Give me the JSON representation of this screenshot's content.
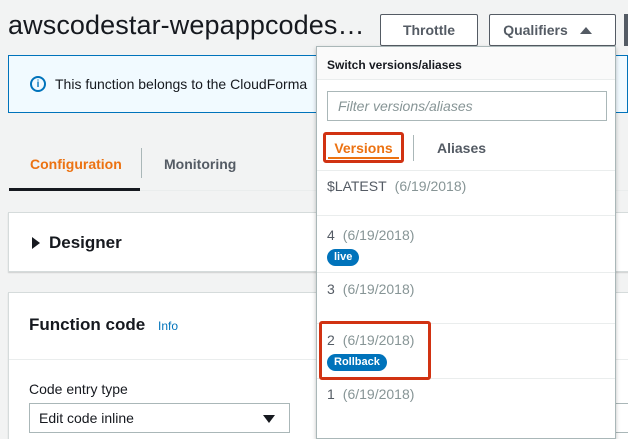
{
  "header": {
    "function_title": "awscodestar-wepappcodes…",
    "throttle_label": "Throttle",
    "qualifiers_label": "Qualifiers"
  },
  "banner": {
    "text": "This function belongs to the CloudForma"
  },
  "tabs": [
    {
      "label": "Configuration",
      "active": true
    },
    {
      "label": "Monitoring",
      "active": false
    }
  ],
  "designer": {
    "title": "Designer"
  },
  "function_code": {
    "title": "Function code",
    "info_link": "Info",
    "entry_type_label": "Code entry type",
    "entry_type_value": "Edit code inline"
  },
  "dropdown": {
    "header": "Switch versions/aliases",
    "filter_placeholder": "Filter versions/aliases",
    "tabs": [
      {
        "label": "Versions",
        "active": true
      },
      {
        "label": "Aliases",
        "active": false
      }
    ],
    "versions": [
      {
        "name": "$LATEST",
        "date": "(6/19/2018)",
        "badge": ""
      },
      {
        "name": "4",
        "date": "(6/19/2018)",
        "badge": "live"
      },
      {
        "name": "3",
        "date": "(6/19/2018)",
        "badge": ""
      },
      {
        "name": "2",
        "date": "(6/19/2018)",
        "badge": "Rollback"
      },
      {
        "name": "1",
        "date": "(6/19/2018)",
        "badge": ""
      }
    ]
  },
  "colors": {
    "accent_orange": "#ec7211",
    "badge_blue": "#0073bb",
    "highlight_red": "#d13212"
  }
}
